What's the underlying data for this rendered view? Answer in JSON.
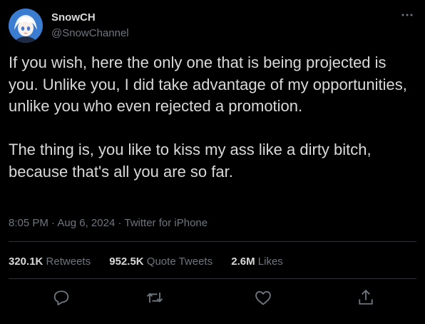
{
  "user": {
    "display_name": "SnowCH",
    "handle": "@SnowChannel",
    "avatar_icon": "anime-avatar-icon"
  },
  "tweet": {
    "paragraphs": [
      "If you wish, here the only one that is being projected is you. Unlike you, I did take advantage of my opportunities, unlike you who even rejected a promotion.",
      "The thing is, you like to kiss my ass like a dirty bitch, because that's all you are so far."
    ],
    "time": "8:05 PM",
    "date": "Aug 6, 2024",
    "source": "Twitter for iPhone"
  },
  "stats": {
    "retweets": {
      "count": "320.1K",
      "label": "Retweets"
    },
    "quote_tweets": {
      "count": "952.5K",
      "label": "Quote Tweets"
    },
    "likes": {
      "count": "2.6M",
      "label": "Likes"
    }
  },
  "actions": [
    "reply-icon",
    "retweet-icon",
    "like-icon",
    "share-icon"
  ],
  "colors": {
    "background": "#000000",
    "text": "#d9d9d9",
    "secondary": "#6e767d",
    "divider": "#2f3336"
  }
}
